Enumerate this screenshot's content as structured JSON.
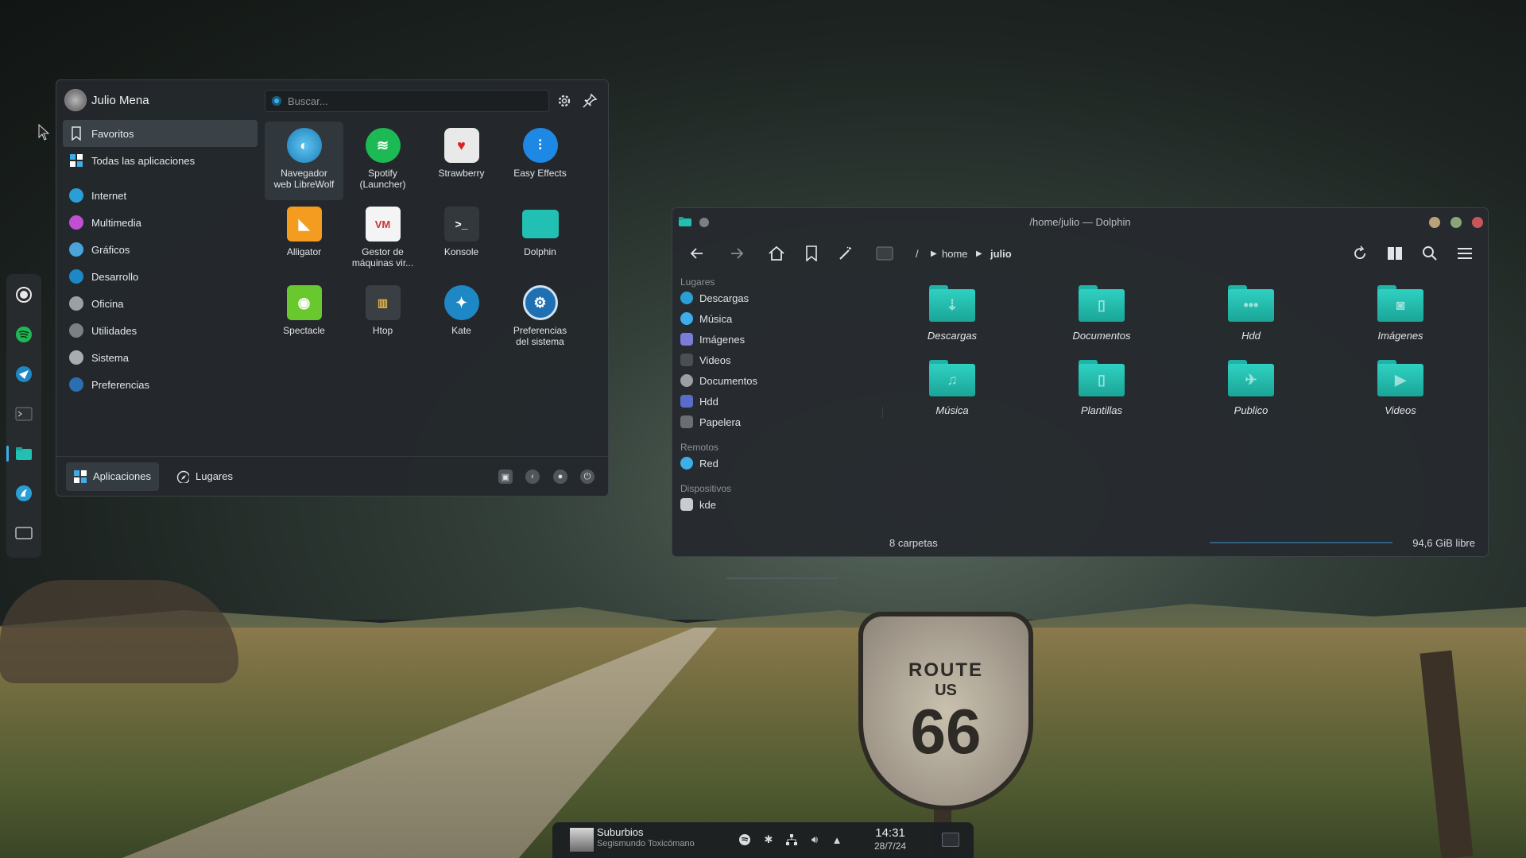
{
  "launcher": {
    "user": "Julio Mena",
    "search_placeholder": "Buscar...",
    "categories": [
      {
        "label": "Favoritos"
      },
      {
        "label": "Todas las aplicaciones"
      },
      {
        "label": "Internet"
      },
      {
        "label": "Multimedia"
      },
      {
        "label": "Gráficos"
      },
      {
        "label": "Desarrollo"
      },
      {
        "label": "Oficina"
      },
      {
        "label": "Utilidades"
      },
      {
        "label": "Sistema"
      },
      {
        "label": "Preferencias"
      }
    ],
    "apps": [
      {
        "line1": "Navegador",
        "line2": "web LibreWolf"
      },
      {
        "line1": "Spotify",
        "line2": "(Launcher)"
      },
      {
        "line1": "Strawberry",
        "line2": ""
      },
      {
        "line1": "Easy Effects",
        "line2": ""
      },
      {
        "line1": "Alligator",
        "line2": ""
      },
      {
        "line1": "Gestor de",
        "line2": "máquinas vir..."
      },
      {
        "line1": "Konsole",
        "line2": ""
      },
      {
        "line1": "Dolphin",
        "line2": ""
      },
      {
        "line1": "Spectacle",
        "line2": ""
      },
      {
        "line1": "Htop",
        "line2": ""
      },
      {
        "line1": "Kate",
        "line2": ""
      },
      {
        "line1": "Preferencias",
        "line2": "del sistema"
      }
    ],
    "tabs": {
      "applications": "Aplicaciones",
      "places": "Lugares"
    }
  },
  "dolphin": {
    "title": "/home/julio — Dolphin",
    "breadcrumb": {
      "root": "/",
      "home": "home",
      "current": "julio"
    },
    "places_heading": "Lugares",
    "places": [
      "Descargas",
      "Música",
      "Imágenes",
      "Videos",
      "Documentos",
      "Hdd",
      "Papelera"
    ],
    "remote_heading": "Remotos",
    "remote": [
      "Red"
    ],
    "devices_heading": "Dispositivos",
    "devices": [
      "kde"
    ],
    "folders": [
      "Descargas",
      "Documentos",
      "Hdd",
      "Imágenes",
      "Música",
      "Plantillas",
      "Publico",
      "Videos"
    ],
    "status_count": "8 carpetas",
    "status_free": "94,6 GiB libre"
  },
  "taskbar": {
    "track_title": "Suburbios",
    "track_artist": "Segismundo Toxicómano",
    "time": "14:31",
    "date": "28/7/24"
  },
  "wallpaper": {
    "sign_top": "ROUTE",
    "sign_mid": "US",
    "sign_num": "66"
  },
  "colors": {
    "accent": "#3daee9",
    "folder": "#22c0b2",
    "panel": "#24282c"
  }
}
